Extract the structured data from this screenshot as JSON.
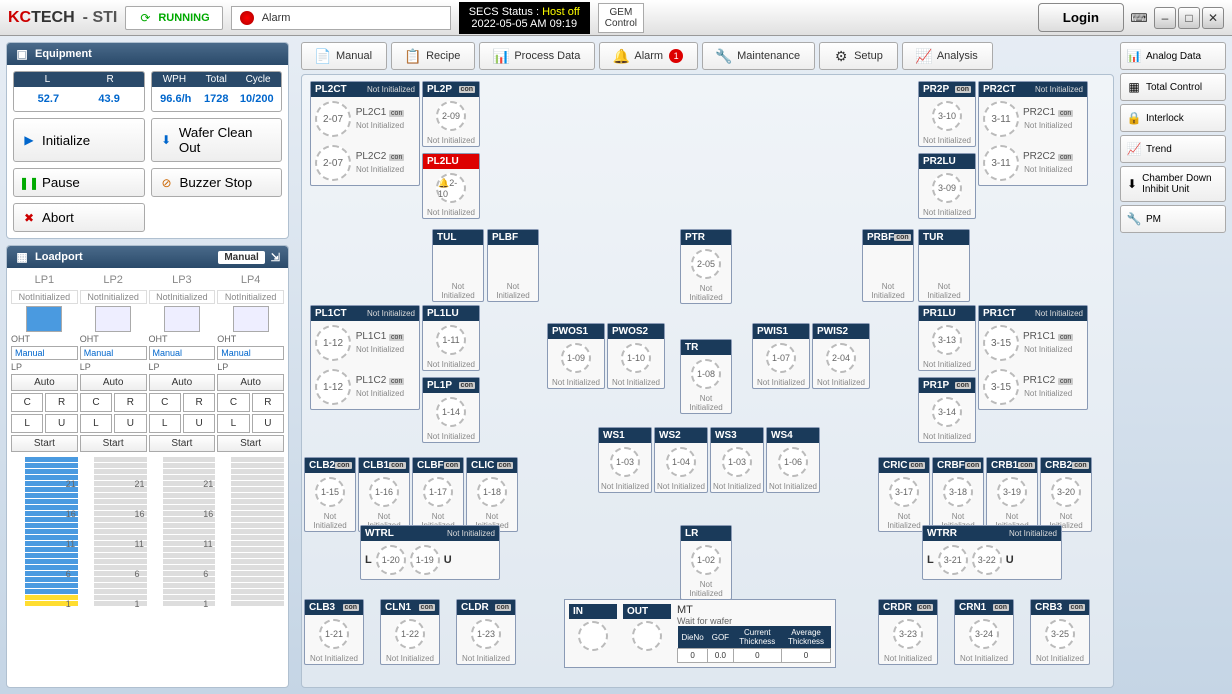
{
  "header": {
    "logo": "KCTECH",
    "suffix": "- STI",
    "running": "RUNNING",
    "alarm": "Alarm",
    "secs_label": "SECS Status :",
    "secs_host": "Host off",
    "secs_time": "2022-05-05 AM 09:19",
    "gem1": "GEM",
    "gem2": "Control",
    "login": "Login"
  },
  "equipment": {
    "title": "Equipment",
    "lr": {
      "L": "52.7",
      "R": "43.9"
    },
    "wph": {
      "WPH": "96.6/h",
      "Total": "1728",
      "Cycle": "10/200"
    },
    "buttons": {
      "init": "Initialize",
      "wco": "Wafer Clean Out",
      "pause": "Pause",
      "buzzer": "Buzzer Stop",
      "abort": "Abort"
    }
  },
  "loadport": {
    "title": "Loadport",
    "mode": "Manual",
    "cols": [
      {
        "name": "LP1",
        "stat": "NotInitialized",
        "oht": "Manual",
        "lp": "Auto"
      },
      {
        "name": "LP2",
        "stat": "NotInitialized",
        "oht": "Manual",
        "lp": "Auto"
      },
      {
        "name": "LP3",
        "stat": "NotInitialized",
        "oht": "Manual",
        "lp": "Auto"
      },
      {
        "name": "LP4",
        "stat": "NotInitialized",
        "oht": "Manual",
        "lp": "Auto"
      }
    ],
    "cr": {
      "c": "C",
      "r": "R",
      "l": "L",
      "u": "U",
      "start": "Start"
    },
    "slot_labels": [
      "1",
      "6",
      "11",
      "16",
      "21"
    ]
  },
  "tabs": {
    "manual": "Manual",
    "recipe": "Recipe",
    "process": "Process Data",
    "alarm": "Alarm",
    "alarm_badge": "1",
    "maint": "Maintenance",
    "setup": "Setup",
    "analysis": "Analysis"
  },
  "rbtns": {
    "analog": "Analog Data",
    "total": "Total Control",
    "interlock": "Interlock",
    "trend": "Trend",
    "chamber": "Chamber Down Inhibit Unit",
    "pm": "PM"
  },
  "ni": "Not Initialized",
  "modules": {
    "PL2CT": {
      "c1": "PL2C1",
      "c2": "PL2C2",
      "w1": "2-07",
      "w2": "2-07"
    },
    "PL2P": {
      "w": "2-09"
    },
    "PL2LU": {
      "w": "2-10"
    },
    "PR2P": {
      "w": "3-10"
    },
    "PR2LU": {
      "w": "3-09"
    },
    "PR2CT": {
      "c1": "PR2C1",
      "c2": "PR2C2",
      "w1": "3-11",
      "w2": "3-11"
    },
    "TUL": {},
    "PLBF": {},
    "PTR": {
      "w": "2-05"
    },
    "PRBF": {},
    "TUR": {},
    "PL1CT": {
      "c1": "PL1C1",
      "c2": "PL1C2",
      "w1": "1-12",
      "w2": "1-12"
    },
    "PL1LU": {
      "w": "1-11"
    },
    "PL1P": {
      "w": "1-14"
    },
    "PWOS1": {
      "w": "1-09"
    },
    "PWOS2": {
      "w": "1-10"
    },
    "TR": {
      "w": "1-08"
    },
    "PWIS1": {
      "w": "1-07"
    },
    "PWIS2": {
      "w": "2-04"
    },
    "PR1LU": {
      "w": "3-13"
    },
    "PR1P": {
      "w": "3-14"
    },
    "PR1CT": {
      "c1": "PR1C1",
      "c2": "PR1C2",
      "w1": "3-15",
      "w2": "3-15"
    },
    "WS1": {
      "w": "1-03"
    },
    "WS2": {
      "w": "1-04"
    },
    "WS3": {
      "w": "1-03"
    },
    "WS4": {
      "w": "1-06"
    },
    "CLB2": {
      "w": "1-15"
    },
    "CLB1": {
      "w": "1-16"
    },
    "CLBF": {
      "w": "1-17"
    },
    "CLIC": {
      "w": "1-18"
    },
    "CRIC": {
      "w": "3-17"
    },
    "CRBF": {
      "w": "3-18"
    },
    "CRB1": {
      "w": "3-19"
    },
    "CRB2": {
      "w": "3-20"
    },
    "WTRL": {
      "l": "L",
      "u": "U",
      "w1": "1-20",
      "w2": "1-19"
    },
    "LR": {
      "w": "1-02"
    },
    "WTRR": {
      "l": "L",
      "u": "U",
      "w1": "3-21",
      "w2": "3-22"
    },
    "CLB3": {
      "w": "1-21"
    },
    "CLN1": {
      "w": "1-22"
    },
    "CLDR": {
      "w": "1-23"
    },
    "CRDR": {
      "w": "3-23"
    },
    "CRN1": {
      "w": "3-24"
    },
    "CRB3": {
      "w": "3-25"
    },
    "MT": {
      "in": "IN",
      "out": "OUT",
      "title": "MT",
      "wait": "Wait for wafer",
      "th": [
        "DieNo",
        "GOF",
        "Current Thickness",
        "Average Thickness"
      ],
      "td": [
        "0",
        "0.0",
        "0",
        "0"
      ]
    }
  }
}
